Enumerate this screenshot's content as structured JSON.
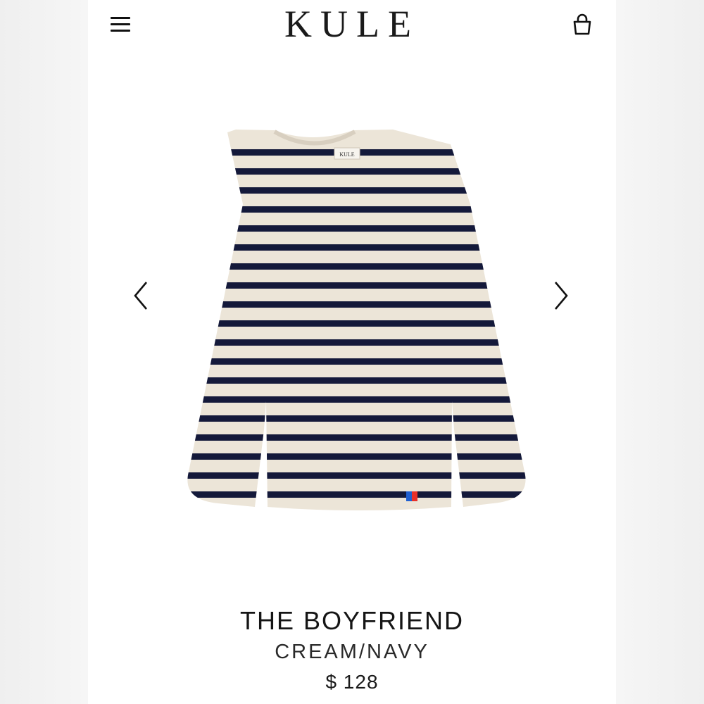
{
  "header": {
    "brand": "KULE",
    "menu_icon": "hamburger-menu-icon",
    "bag_icon": "shopping-bag-icon"
  },
  "gallery": {
    "prev_icon": "chevron-left-icon",
    "next_icon": "chevron-right-icon",
    "label_text": "KULE"
  },
  "product": {
    "name": "THE BOYFRIEND",
    "color": "CREAM/NAVY",
    "price": "$ 128"
  },
  "colors": {
    "cream": "#ece5d8",
    "navy": "#14193a",
    "patch_blue": "#1f5fd0",
    "patch_red": "#e8302a"
  }
}
